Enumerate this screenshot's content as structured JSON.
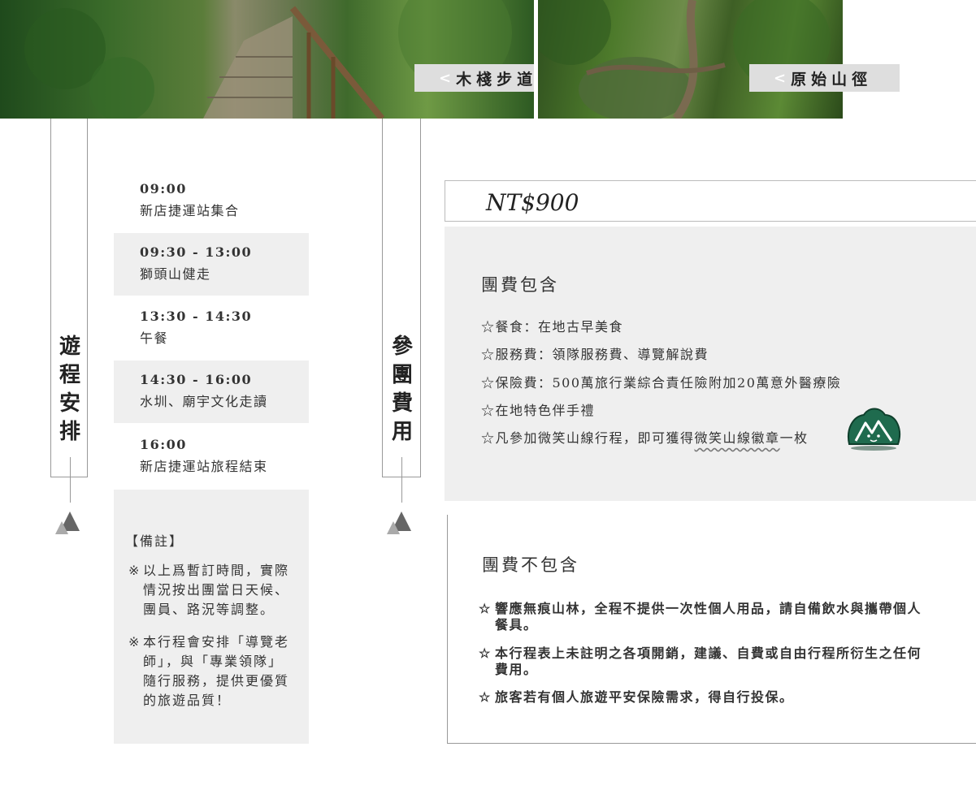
{
  "photos": [
    {
      "label": "木棧步道",
      "chevron": "<"
    },
    {
      "label": "原始山徑",
      "chevron": "<"
    }
  ],
  "schedule_tab": [
    "遊",
    "程",
    "安",
    "排"
  ],
  "fee_tab": [
    "參",
    "團",
    "費",
    "用"
  ],
  "schedule": [
    {
      "time": "09:00",
      "desc": "新店捷運站集合"
    },
    {
      "time": "09:30 - 13:00",
      "desc": "獅頭山健走"
    },
    {
      "time": "13:30 - 14:30",
      "desc": "午餐"
    },
    {
      "time": "14:30 - 16:00",
      "desc": "水圳、廟宇文化走讀"
    },
    {
      "time": "16:00",
      "desc": "新店捷運站旅程結束"
    }
  ],
  "notes": {
    "title": "【備註】",
    "marker": "※",
    "items": [
      "以上爲暫訂時間，實際情況按出團當日天候、團員、路況等調整。",
      "本行程會安排「導覽老師」，與「專業領隊」隨行服務，提供更優質的旅遊品質！"
    ]
  },
  "price": "NT$900",
  "included": {
    "title": "團費包含",
    "items": [
      "☆餐食：在地古早美食",
      "☆服務費：領隊服務費、導覽解說費",
      "☆保險費：500萬旅行業綜合責任險附加20萬意外醫療險",
      "☆在地特色伴手禮"
    ],
    "last_prefix": "☆凡參加",
    "last_mid1": "微笑山線",
    "last_mid2": "行程，即可獲得",
    "last_highlight": "微笑山線徽章",
    "last_suffix": "一枚",
    "badge_icon": "smile-mountain-badge-icon",
    "badge_color": "#1f6b4e"
  },
  "excluded": {
    "title": "團費不包含",
    "marker": "☆",
    "items": [
      "響應無痕山林，全程不提供一次性個人用品，請自備飲水與攜帶個人餐具。",
      "本行程表上未註明之各項開銷，建議、自費或自由行程所衍生之任何費用。",
      "旅客若有個人旅遊平安保險需求，得自行投保。"
    ]
  },
  "colors": {
    "panel": "#efefef",
    "line": "#999999",
    "triangle_dark": "#666666",
    "triangle_light": "#aaaaaa"
  }
}
